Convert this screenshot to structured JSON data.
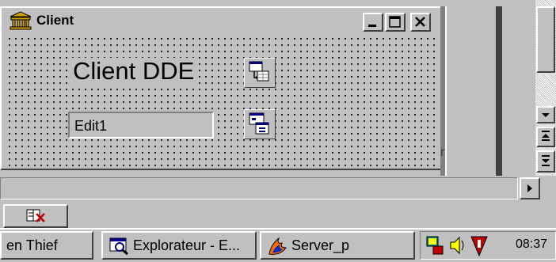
{
  "form": {
    "title": "Client",
    "label": "Client DDE",
    "edit_text": "Edit1",
    "buttons": {
      "minimize": "_",
      "maximize": "□",
      "close": "✕"
    }
  },
  "taskbar": {
    "items": [
      {
        "label": "en Thief"
      },
      {
        "label": "Explorateur - E..."
      },
      {
        "label": "Server_p"
      }
    ],
    "clock": "08:37"
  },
  "colors": {
    "face": "#c0c0c0",
    "shadow": "#808080",
    "highlight": "#ffffff",
    "dark": "#404040"
  }
}
